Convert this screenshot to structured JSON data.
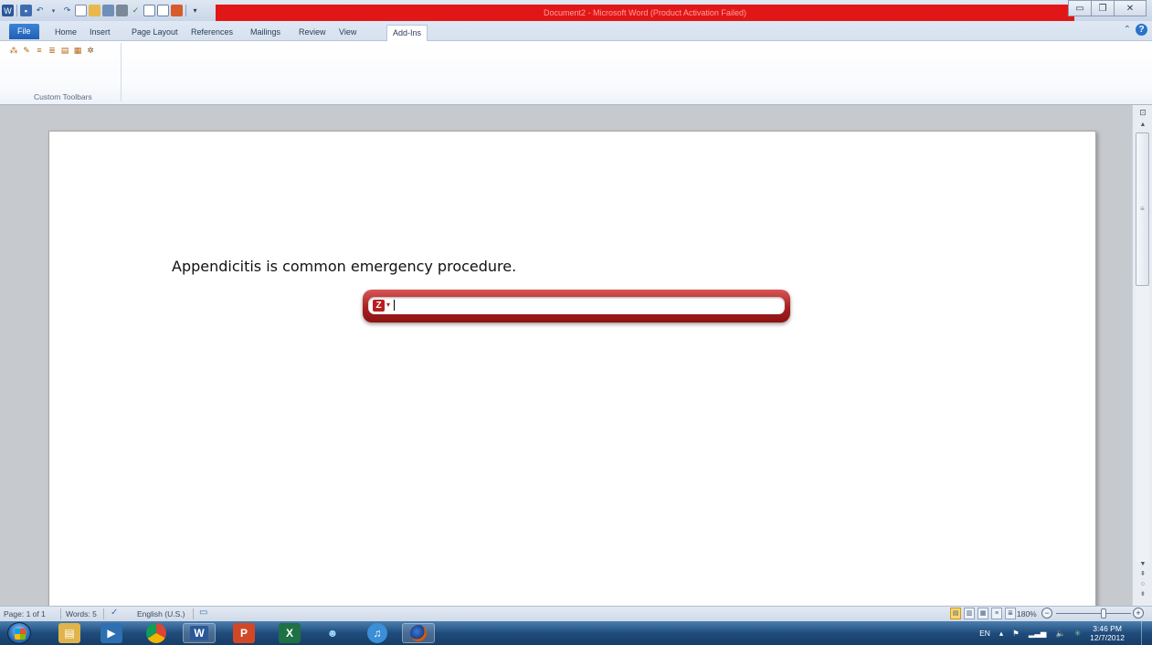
{
  "window": {
    "title": "Document2 - Microsoft Word (Product Activation Failed)",
    "controls": {
      "minimize": "▭",
      "restore": "❐",
      "close": "✕"
    }
  },
  "quick_access": {
    "icons": [
      "word-app-icon",
      "save-icon",
      "undo-icon",
      "redo-icon",
      "new-document-icon",
      "open-icon",
      "print-preview-icon",
      "print-icon",
      "spelling-icon",
      "print-layout-icon",
      "draw-table-icon",
      "insert-picture-icon",
      "customize-qat-icon"
    ]
  },
  "ribbon": {
    "tabs": [
      "File",
      "Home",
      "Insert",
      "Page Layout",
      "References",
      "Mailings",
      "Review",
      "View",
      "Add-Ins"
    ],
    "active_tab": "Add-Ins",
    "group_label": "Custom Toolbars",
    "tool_icons": [
      "toolbar-tool-1-icon",
      "toolbar-tool-2-icon",
      "toolbar-tool-3-icon",
      "toolbar-tool-4-icon",
      "toolbar-tool-5-icon",
      "toolbar-tool-6-icon",
      "toolbar-tool-7-icon"
    ]
  },
  "document": {
    "text": "Appendicitis is common emergency procedure.",
    "findbar": {
      "logo": "Z",
      "dropdown": "▾",
      "value": ""
    }
  },
  "status": {
    "page": "Page: 1 of 1",
    "words": "Words: 5",
    "language": "English (U.S.)",
    "zoom": "180%",
    "zoom_minus": "−",
    "zoom_plus": "+"
  },
  "taskbar": {
    "apps": [
      "windows-explorer-icon",
      "media-player-icon",
      "chrome-icon",
      "word-icon",
      "powerpoint-icon",
      "excel-icon",
      "windows-live-icon",
      "itunes-icon",
      "firefox-icon"
    ],
    "tray": {
      "language": "EN",
      "time": "3:46 PM",
      "date": "12/7/2012"
    }
  }
}
